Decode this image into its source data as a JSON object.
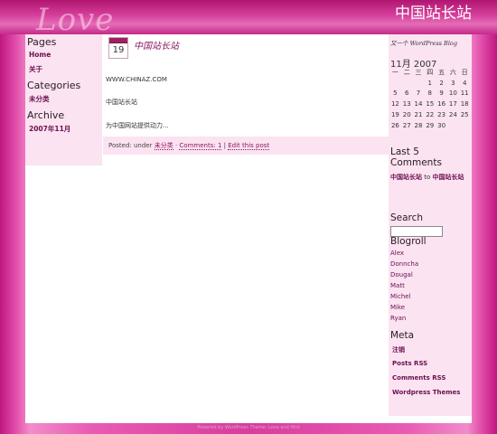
{
  "header": {
    "logo_text": "Love",
    "site_title": "中国站长站"
  },
  "left_sidebar": {
    "pages_heading": "Pages",
    "pages": [
      "Home",
      "关于"
    ],
    "categories_heading": "Categories",
    "categories": [
      "未分类"
    ],
    "archive_heading": "Archive",
    "archives": [
      "2007年11月"
    ]
  },
  "post": {
    "date_day": "19",
    "title": "中国站长站",
    "paragraphs": [
      "WWW.CHINAZ.COM",
      "中国站长站",
      "为中国网站提供动力..."
    ],
    "meta_prefix": "Posted: under",
    "meta_category": "未分类",
    "meta_comments": "Comments: 1",
    "meta_separator": "|",
    "meta_edit": "Edit this post"
  },
  "right_sidebar": {
    "tagline": "又一个 WordPress Blog",
    "calendar_caption": "11月  2007",
    "weekdays": [
      "一",
      "二",
      "三",
      "四",
      "五",
      "六",
      "日"
    ],
    "weeks": [
      [
        "",
        "",
        "",
        "1",
        "2",
        "3",
        "4"
      ],
      [
        "5",
        "6",
        "7",
        "8",
        "9",
        "10",
        "11"
      ],
      [
        "12",
        "13",
        "14",
        "15",
        "16",
        "17",
        "18"
      ],
      [
        "19",
        "20",
        "21",
        "22",
        "23",
        "24",
        "25"
      ],
      [
        "26",
        "27",
        "28",
        "29",
        "30",
        "",
        ""
      ]
    ],
    "last_comments_heading": "Last 5 Comments",
    "comment_author": "中国站长站",
    "comment_to": "to",
    "comment_post": "中国站长站",
    "search_heading": "Search",
    "blogroll_heading": "Blogroll",
    "blogroll": [
      "Alex",
      "Donncha",
      "Dougal",
      "Matt",
      "Michel",
      "Mike",
      "Ryan"
    ],
    "meta_heading": "Meta",
    "meta": [
      "注销",
      "Posts RSS",
      "Comments RSS",
      "Wordpress Themes"
    ]
  },
  "footer": {
    "text": "Powered by WordPress Theme: Love and Hint"
  }
}
